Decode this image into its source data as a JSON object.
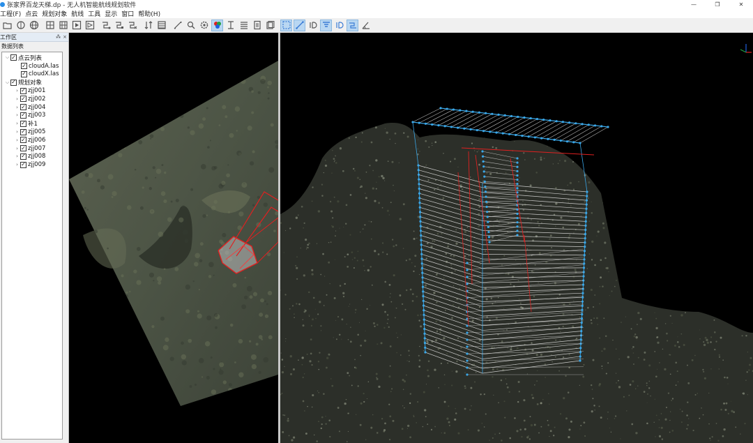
{
  "window": {
    "title": "张家界百龙天梯.dp - 无人机智能航线规划软件",
    "controls": [
      "—",
      "❐",
      "✕"
    ]
  },
  "menu": [
    {
      "label": "工程(F)"
    },
    {
      "label": "点云"
    },
    {
      "label": "规划对象"
    },
    {
      "label": "航线"
    },
    {
      "label": "工具"
    },
    {
      "label": "显示"
    },
    {
      "label": "窗口"
    },
    {
      "label": "帮助(H)"
    }
  ],
  "toolbar": {
    "buttons": [
      {
        "icon": "open-folder-icon"
      },
      {
        "icon": "point-cloud-icon"
      },
      {
        "icon": "globe-icon"
      },
      {
        "icon": "frame-icon"
      },
      {
        "icon": "grid-icon"
      },
      {
        "icon": "play-icon"
      },
      {
        "icon": "export-icon"
      },
      {
        "icon": "route-add-icon"
      },
      {
        "icon": "route-edit-icon"
      },
      {
        "icon": "route-delete-icon"
      },
      {
        "icon": "sort-icon"
      },
      {
        "icon": "table-icon"
      },
      {
        "icon": "measure-icon"
      },
      {
        "icon": "zoom-icon"
      },
      {
        "icon": "settings-icon"
      },
      {
        "icon": "color-icon"
      },
      {
        "icon": "text-cursor-icon"
      },
      {
        "icon": "list-icon"
      },
      {
        "icon": "document-icon"
      },
      {
        "icon": "layers-icon"
      },
      {
        "icon": "select-icon"
      },
      {
        "icon": "line-icon"
      },
      {
        "icon": "id-icon"
      },
      {
        "icon": "filter-icon"
      },
      {
        "icon": "id-alt-icon"
      },
      {
        "icon": "link-icon"
      },
      {
        "icon": "angle-icon"
      }
    ]
  },
  "panel": {
    "title": "工作区",
    "header_buttons": [
      "⁂",
      "×"
    ],
    "subheader": "数据列表",
    "tree": [
      {
        "label": "点云列表",
        "level": 0,
        "expanded": true,
        "checked": true
      },
      {
        "label": "cloudA.las",
        "level": 1,
        "leaf": true,
        "checked": true
      },
      {
        "label": "cloudX.las",
        "level": 1,
        "leaf": true,
        "checked": true
      },
      {
        "label": "规划对象",
        "level": 0,
        "expanded": true,
        "checked": true
      },
      {
        "label": "zjj001",
        "level": 1,
        "leaf": false,
        "checked": true
      },
      {
        "label": "zjj002",
        "level": 1,
        "leaf": false,
        "checked": true
      },
      {
        "label": "zjj004",
        "level": 1,
        "leaf": false,
        "checked": true
      },
      {
        "label": "zjj003",
        "level": 1,
        "leaf": false,
        "checked": true
      },
      {
        "label": "补1",
        "level": 1,
        "leaf": false,
        "checked": true
      },
      {
        "label": "zjj005",
        "level": 1,
        "leaf": false,
        "checked": true
      },
      {
        "label": "zjj006",
        "level": 1,
        "leaf": false,
        "checked": true
      },
      {
        "label": "zjj007",
        "level": 1,
        "leaf": false,
        "checked": true
      },
      {
        "label": "zjj008",
        "level": 1,
        "leaf": false,
        "checked": true
      },
      {
        "label": "zjj009",
        "level": 1,
        "leaf": false,
        "checked": true
      }
    ]
  },
  "views": {
    "background_color": "#000000",
    "route_color_blue": "#3aa7e8",
    "route_color_red": "#e02020",
    "route_color_white": "#e8e8e8",
    "point_cloud_color": "#6f7360"
  }
}
